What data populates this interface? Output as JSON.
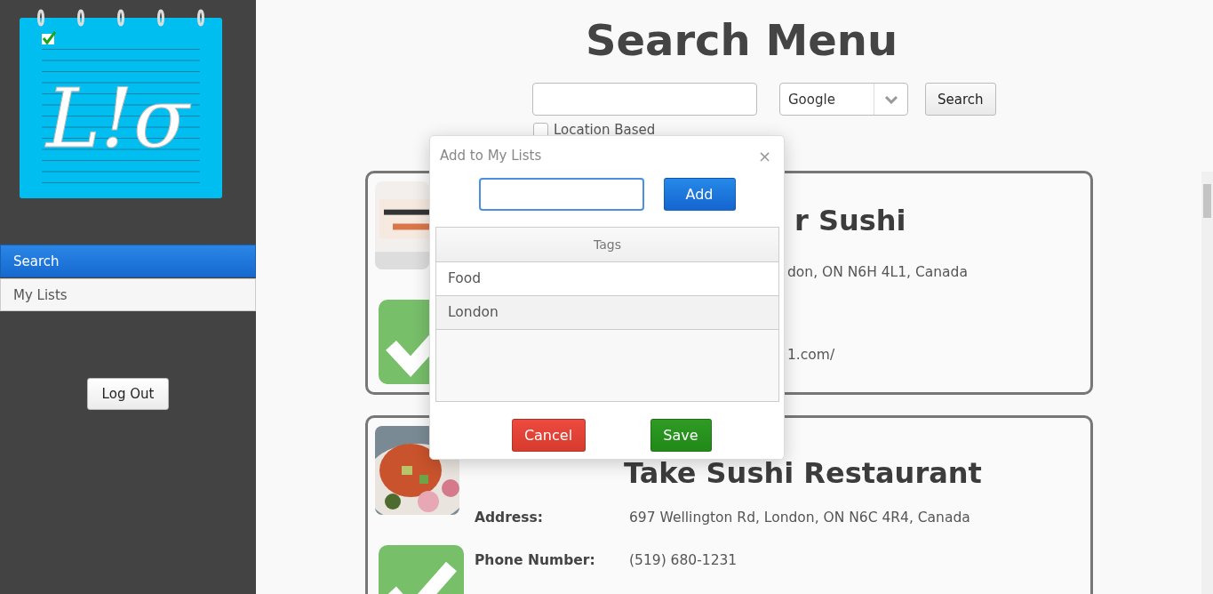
{
  "sidebar": {
    "logo_text": "L!σ",
    "items": [
      {
        "label": "Search",
        "selected": true
      },
      {
        "label": "My Lists",
        "selected": false
      }
    ],
    "logout": "Log Out"
  },
  "header": {
    "title": "Search Menu"
  },
  "search": {
    "engine": "Google",
    "button": "Search",
    "location_based": {
      "label": "Location Based",
      "checked": false
    }
  },
  "results": [
    {
      "title": "r Sushi",
      "fields": [
        {
          "value": "don, ON N6H 4L1, Canada"
        },
        {
          "value": "1.com/"
        }
      ]
    },
    {
      "title": "Take Sushi Restaurant",
      "fields": [
        {
          "label": "Address:",
          "value": "697 Wellington Rd, London, ON N6C 4R4, Canada"
        },
        {
          "label": "Phone Number:",
          "value": "(519) 680-1231"
        }
      ]
    }
  ],
  "dialog": {
    "title": "Add to My Lists",
    "close": "×",
    "add_button": "Add",
    "tags_header": "Tags",
    "tags": [
      {
        "label": "Food",
        "selected": false
      },
      {
        "label": "London",
        "selected": true
      }
    ],
    "cancel": "Cancel",
    "save": "Save"
  }
}
